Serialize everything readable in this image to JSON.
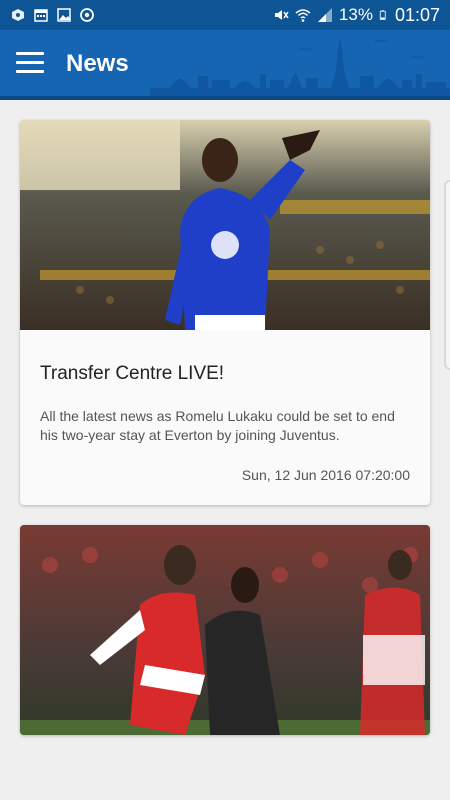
{
  "status_bar": {
    "battery": "13%",
    "time": "01:07"
  },
  "app_bar": {
    "title": "News",
    "menu_icon": "hamburger-menu-icon"
  },
  "articles": [
    {
      "title": "Transfer Centre LIVE!",
      "description": "All the latest news as Romelu Lukaku could be set to end his two-year stay at Everton by joining Juventus.",
      "date": "Sun, 12 Jun 2016 07:20:00"
    },
    {
      "title": "",
      "description": "",
      "date": ""
    }
  ],
  "colors": {
    "status_bar": "#0e5596",
    "app_bar": "#1565b3",
    "background": "#efefef",
    "card": "#fafafa"
  }
}
